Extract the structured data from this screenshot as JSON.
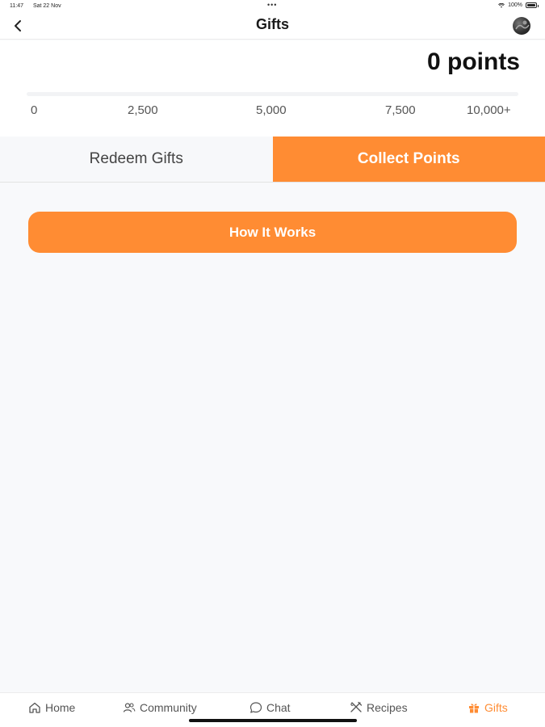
{
  "status_bar": {
    "time": "11:47",
    "date": "Sat 22 Nov",
    "dots": "•••",
    "battery": "100%"
  },
  "header": {
    "title": "Gifts"
  },
  "points": {
    "total_label": "0 points",
    "progress": 0,
    "scale": [
      "0",
      "2,500",
      "5,000",
      "7,500",
      "10,000+"
    ]
  },
  "tabs": [
    {
      "label": "Redeem Gifts",
      "selected": false
    },
    {
      "label": "Collect Points",
      "selected": true
    }
  ],
  "how_it_works": {
    "label": "How It Works"
  },
  "tab_bar": {
    "items": [
      {
        "label": "Home",
        "icon": "home-icon"
      },
      {
        "label": "Community",
        "icon": "community-icon"
      },
      {
        "label": "Chat",
        "icon": "chat-icon"
      },
      {
        "label": "Recipes",
        "icon": "recipes-icon"
      },
      {
        "label": "Gifts",
        "icon": "gift-icon",
        "active": true
      }
    ]
  },
  "colors": {
    "accent": "#ff8c33",
    "background": "#f8f9fb",
    "surface": "#ffffff"
  }
}
